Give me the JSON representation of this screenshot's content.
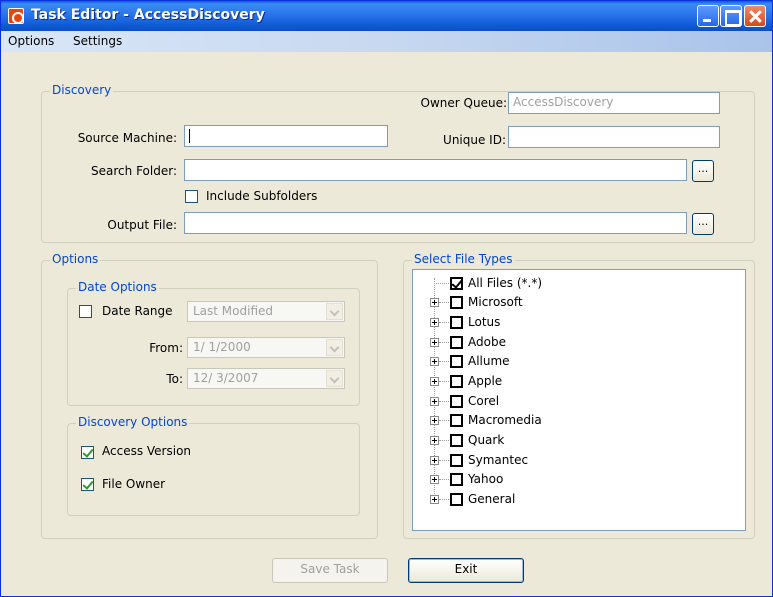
{
  "window": {
    "title": "Task Editor - AccessDiscovery"
  },
  "menu": {
    "items": [
      "Options",
      "Settings"
    ]
  },
  "discovery": {
    "group_title": "Discovery",
    "owner_queue_label": "Owner Queue:",
    "owner_queue_value": "AccessDiscovery",
    "source_machine_label": "Source Machine:",
    "source_machine_value": "",
    "unique_id_label": "Unique ID:",
    "unique_id_value": "",
    "search_folder_label": "Search Folder:",
    "search_folder_value": "",
    "include_subfolders_label": "Include Subfolders",
    "include_subfolders_checked": false,
    "output_file_label": "Output File:",
    "output_file_value": "",
    "browse_label": "..."
  },
  "options": {
    "group_title": "Options",
    "date_options": {
      "group_title": "Date Options",
      "date_range_label": "Date Range",
      "date_range_checked": false,
      "date_type_value": "Last Modified",
      "from_label": "From:",
      "from_value": "1/ 1/2000",
      "to_label": "To:",
      "to_value": "12/ 3/2007"
    },
    "discovery_options": {
      "group_title": "Discovery Options",
      "access_version_label": "Access Version",
      "access_version_checked": true,
      "file_owner_label": "File Owner",
      "file_owner_checked": true
    }
  },
  "file_types": {
    "group_title": "Select File Types",
    "items": [
      {
        "label": "All Files (*.*)",
        "checked": true,
        "expandable": false
      },
      {
        "label": "Microsoft",
        "checked": false,
        "expandable": true
      },
      {
        "label": "Lotus",
        "checked": false,
        "expandable": true
      },
      {
        "label": "Adobe",
        "checked": false,
        "expandable": true
      },
      {
        "label": "Allume",
        "checked": false,
        "expandable": true
      },
      {
        "label": "Apple",
        "checked": false,
        "expandable": true
      },
      {
        "label": "Corel",
        "checked": false,
        "expandable": true
      },
      {
        "label": "Macromedia",
        "checked": false,
        "expandable": true
      },
      {
        "label": "Quark",
        "checked": false,
        "expandable": true
      },
      {
        "label": "Symantec",
        "checked": false,
        "expandable": true
      },
      {
        "label": "Yahoo",
        "checked": false,
        "expandable": true
      },
      {
        "label": "General",
        "checked": false,
        "expandable": true
      }
    ]
  },
  "buttons": {
    "save_label": "Save Task",
    "save_enabled": false,
    "exit_label": "Exit"
  }
}
